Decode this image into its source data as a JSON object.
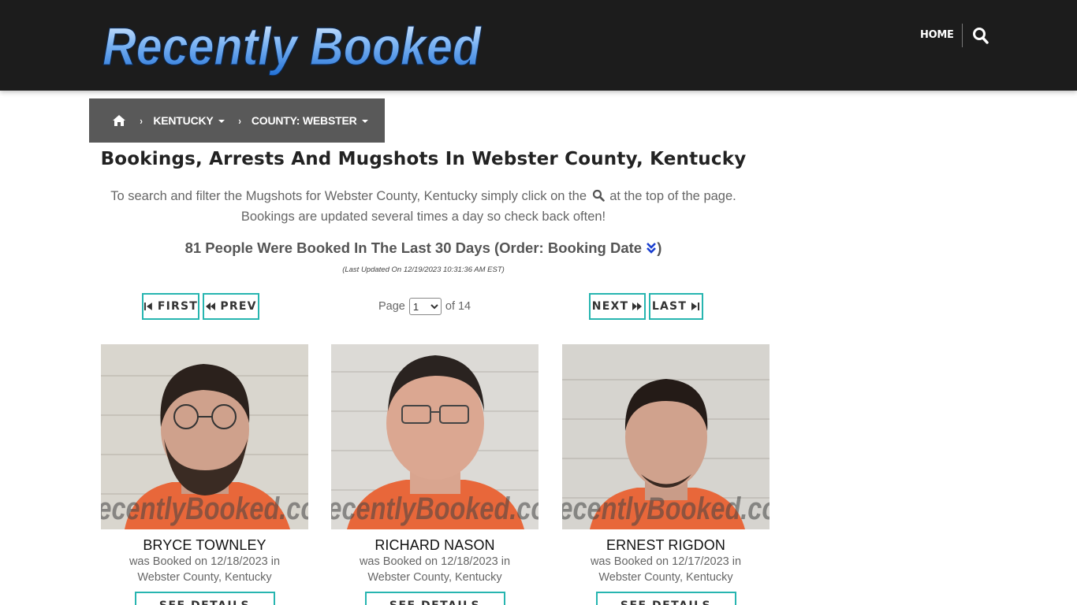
{
  "header": {
    "logo_text": "Recently Booked",
    "nav_home": "HOME",
    "search_icon": "search-icon"
  },
  "breadcrumb": {
    "home_icon": "home-icon",
    "state": "KENTUCKY",
    "county": "COUNTY: WEBSTER",
    "separator": "›"
  },
  "main": {
    "title": "Bookings, Arrests And Mugshots In Webster County, Kentucky",
    "intro_part1": "To search and filter the Mugshots for Webster County, Kentucky simply click on the",
    "intro_part2": "at the top of the page.",
    "intro_line2": "Bookings are updated several times a day so check back often!",
    "count_text": "81 People Were Booked In The Last 30 Days (Order: Booking Date",
    "count_close": ")",
    "last_updated": "(Last Updated On 12/19/2023 10:31:36 AM EST)"
  },
  "pager": {
    "first": "FIRST",
    "prev": "PREV",
    "next": "NEXT",
    "last": "LAST",
    "page_label": "Page",
    "current_page": "1",
    "of_label": "of 14",
    "accent": "#27b5b0"
  },
  "watermark": "RecentlyBooked.com",
  "cards": [
    {
      "name": "BRYCE TOWNLEY",
      "booked_line": "was Booked on 12/18/2023 in",
      "location": "Webster County, Kentucky",
      "button": "SEE DETAILS"
    },
    {
      "name": "RICHARD NASON",
      "booked_line": "was Booked on 12/18/2023 in",
      "location": "Webster County, Kentucky",
      "button": "SEE DETAILS"
    },
    {
      "name": "ERNEST RIGDON",
      "booked_line": "was Booked on 12/17/2023 in",
      "location": "Webster County, Kentucky",
      "button": "SEE DETAILS"
    }
  ],
  "colors": {
    "header_bg": "#1c1c1c",
    "breadcrumb_bg": "#595959",
    "accent": "#27b5b0",
    "logo_blue": "#3b8fe8"
  }
}
